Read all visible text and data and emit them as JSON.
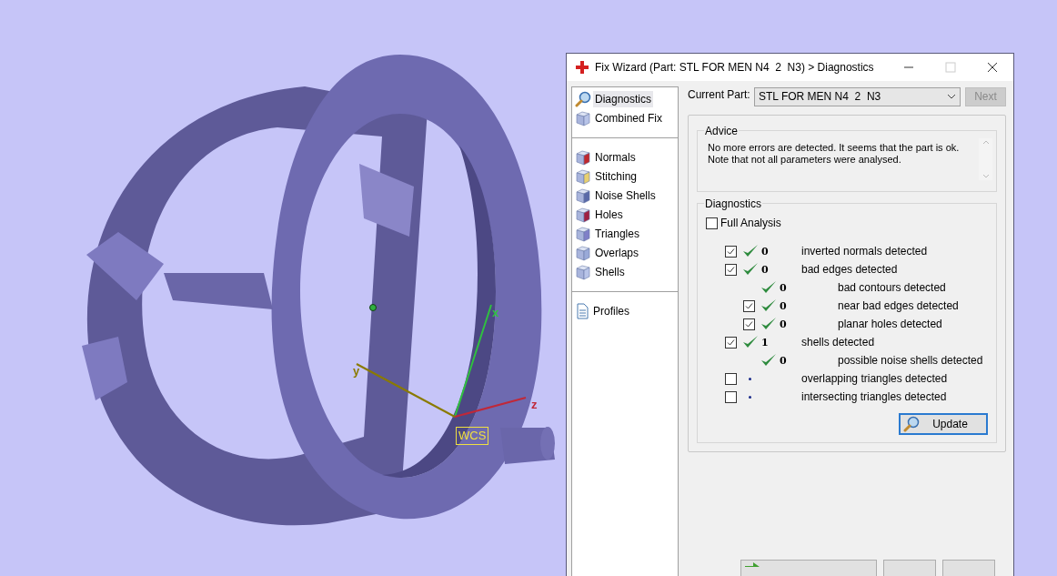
{
  "viewport": {
    "axes": [
      {
        "label": "x",
        "kind": "x"
      },
      {
        "label": "y",
        "kind": "y"
      },
      {
        "label": "z",
        "kind": "z"
      }
    ],
    "wcs_label": "WCS"
  },
  "dialog": {
    "title": "Fix Wizard (Part: STL FOR MEN N4  2  N3) > Diagnostics",
    "nav_groups": [
      [
        {
          "label": "Diagnostics",
          "kind": "search",
          "selected": true
        },
        {
          "label": "Combined Fix",
          "kind": "sheets",
          "selected": false
        }
      ],
      [
        {
          "label": "Normals",
          "kind": "normals",
          "selected": false
        },
        {
          "label": "Stitching",
          "kind": "stitching",
          "selected": false
        },
        {
          "label": "Noise Shells",
          "kind": "noise",
          "selected": false
        },
        {
          "label": "Holes",
          "kind": "holes",
          "selected": false
        },
        {
          "label": "Triangles",
          "kind": "triangles",
          "selected": false
        },
        {
          "label": "Overlaps",
          "kind": "overlaps",
          "selected": false
        },
        {
          "label": "Shells",
          "kind": "shells",
          "selected": false
        }
      ],
      [
        {
          "label": "Profiles",
          "kind": "document",
          "selected": false
        }
      ]
    ],
    "current_part": {
      "label": "Current Part:",
      "value": "STL FOR MEN N4  2  N3"
    },
    "next_button": {
      "label": "Next",
      "disabled": true
    },
    "advice": {
      "title": "Advice",
      "lines": [
        "No more errors are detected. It seems that the part is ok.",
        "Note that not all parameters were analysed."
      ]
    },
    "diagnostics": {
      "title": "Diagnostics",
      "full_analysis": {
        "label": "Full Analysis",
        "checked": false
      },
      "checks": [
        {
          "kind": "check",
          "checked": true,
          "ok": true,
          "count": "0",
          "label": "inverted normals detected"
        },
        {
          "kind": "check",
          "checked": true,
          "ok": true,
          "count": "0",
          "label": "bad edges detected",
          "children": [
            {
              "kind": "plain",
              "ok": true,
              "count": "0",
              "label": "bad contours detected"
            },
            {
              "kind": "check",
              "checked": true,
              "ok": true,
              "count": "0",
              "label": "near bad edges detected"
            },
            {
              "kind": "check",
              "checked": true,
              "ok": true,
              "count": "0",
              "label": "planar holes detected"
            }
          ]
        },
        {
          "kind": "check",
          "checked": true,
          "ok": true,
          "count": "1",
          "label": "shells detected",
          "children": [
            {
              "kind": "plain",
              "ok": true,
              "count": "0",
              "label": "possible noise shells detected"
            }
          ]
        },
        {
          "kind": "check",
          "checked": false,
          "ok": false,
          "label": "overlapping triangles detected"
        },
        {
          "kind": "check",
          "checked": false,
          "ok": false,
          "label": "intersecting triangles detected"
        }
      ],
      "update_button": "Update"
    },
    "footer_buttons": [
      {
        "kind": "arrow"
      },
      {
        "kind": "plain"
      },
      {
        "kind": "plain"
      }
    ]
  }
}
